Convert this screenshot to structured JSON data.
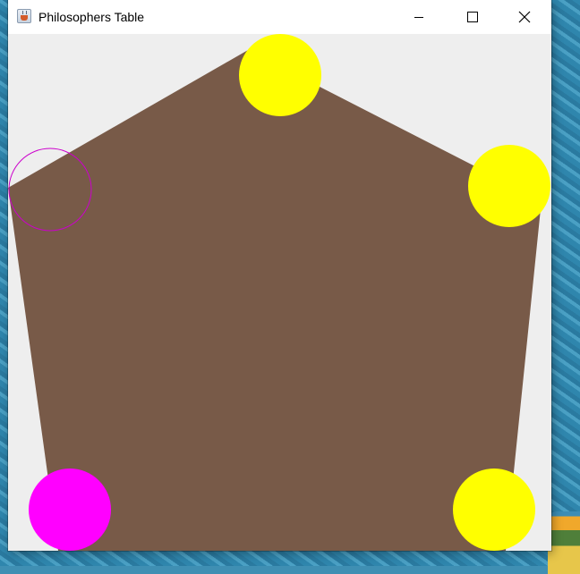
{
  "window": {
    "title": "Philosophers Table",
    "app_icon": "java-cup-icon",
    "controls": {
      "minimize_icon": "minimize-icon",
      "maximize_icon": "maximize-icon",
      "close_icon": "close-icon"
    }
  },
  "scene": {
    "table_color": "#785a48",
    "background_color": "#eeeeee",
    "philosophers": [
      {
        "id": 1,
        "state_color": "#ffff00",
        "filled": true
      },
      {
        "id": 2,
        "state_color": "#ffff00",
        "filled": true
      },
      {
        "id": 3,
        "state_color": "#ffff00",
        "filled": true
      },
      {
        "id": 4,
        "state_color": "#ff00ff",
        "filled": true
      },
      {
        "id": 5,
        "state_color": "#cc00cc",
        "filled": false
      }
    ]
  }
}
